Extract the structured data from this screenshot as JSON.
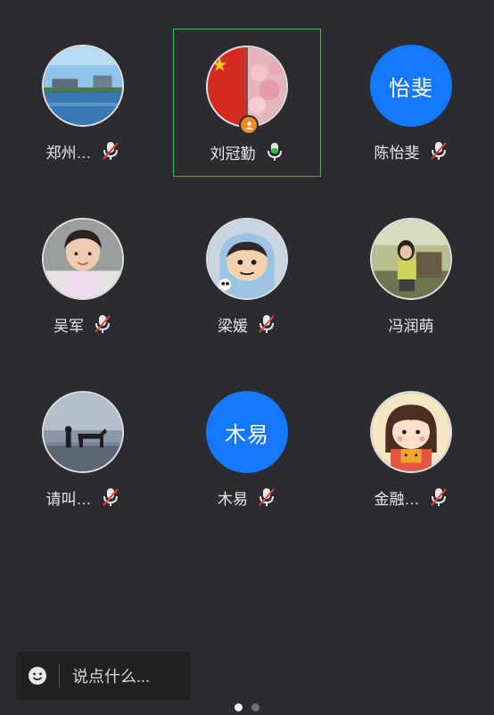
{
  "participants": [
    {
      "name": "郑州…",
      "avatar": "photo-harbor-city",
      "mic": "muted",
      "speaking": false,
      "host": false
    },
    {
      "name": "刘冠勤",
      "avatar": "photo-flag-blossom",
      "mic": "active",
      "speaking": true,
      "host": true
    },
    {
      "name": "陈怡斐",
      "avatar_text": "怡斐",
      "mic": "muted",
      "speaking": false,
      "host": false
    },
    {
      "name": "吴军",
      "avatar": "photo-toddler",
      "mic": "muted",
      "speaking": false,
      "host": false
    },
    {
      "name": "梁媛",
      "avatar": "cartoon-boy",
      "mic": "muted",
      "speaking": false,
      "host": false
    },
    {
      "name": "冯润萌",
      "avatar": "photo-girl-chair",
      "mic": "none",
      "speaking": false,
      "host": false
    },
    {
      "name": "请叫…",
      "avatar": "photo-horse-beach",
      "mic": "muted",
      "speaking": false,
      "host": false
    },
    {
      "name": "木易",
      "avatar_text": "木易",
      "mic": "muted",
      "speaking": false,
      "host": false
    },
    {
      "name": "金融…",
      "avatar": "cartoon-girl-tiger",
      "mic": "muted",
      "speaking": false,
      "host": false
    }
  ],
  "chat": {
    "placeholder": "说点什么...",
    "emoji_icon": "smile-icon"
  },
  "pager": {
    "total": 2,
    "current": 1
  },
  "colors": {
    "background": "#2a2c2f",
    "speaking_border": "#2fbf50",
    "text_avatar": "#1677ff",
    "muted_slash": "#e0443b",
    "active_mic": "#2fbf50",
    "host_badge": "#f08a1c"
  }
}
